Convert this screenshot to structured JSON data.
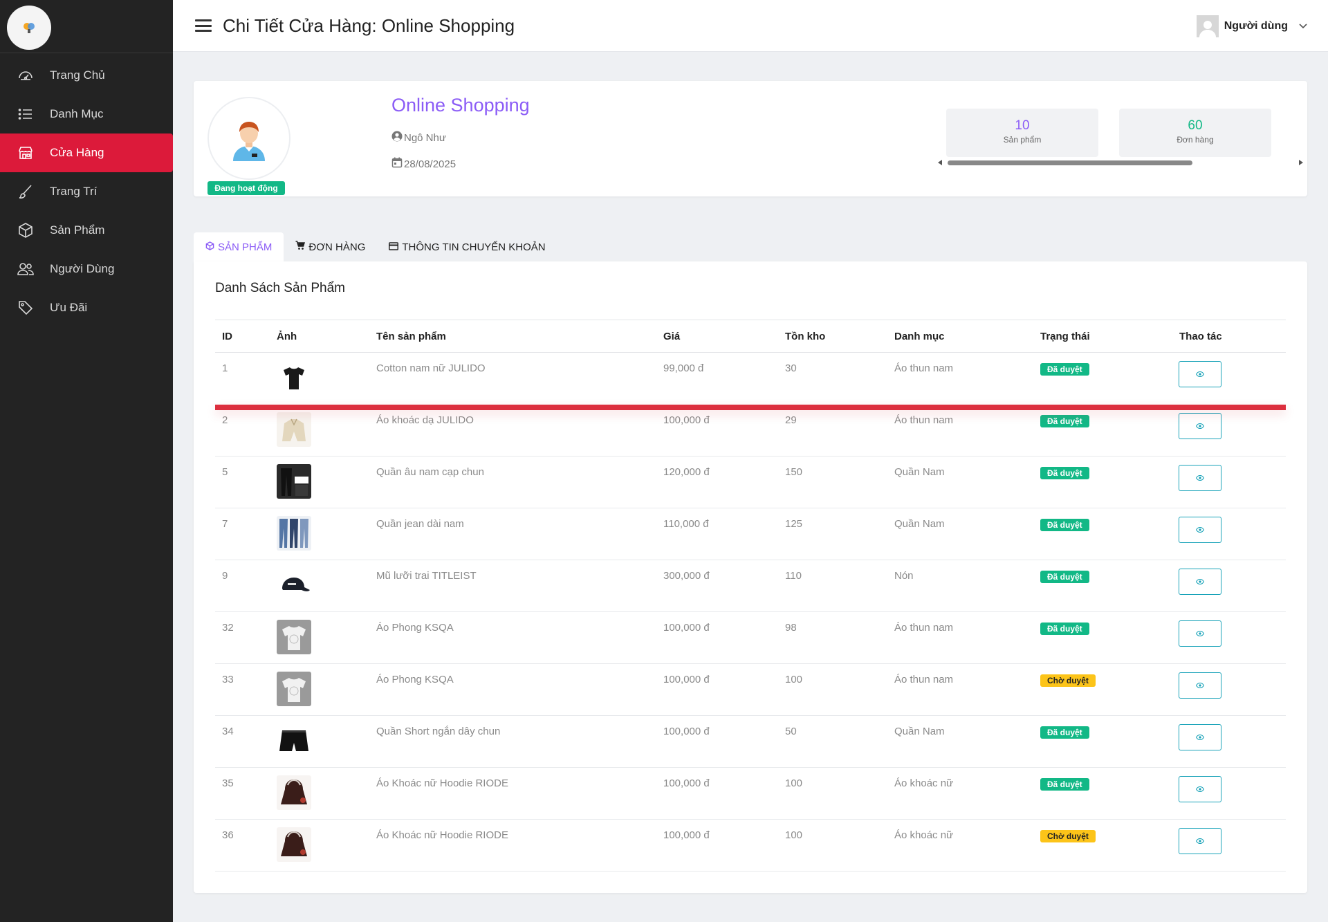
{
  "sidebar": {
    "items": [
      {
        "label": "Trang Chủ",
        "icon": "dashboard-icon"
      },
      {
        "label": "Danh Mục",
        "icon": "list-icon"
      },
      {
        "label": "Cửa Hàng",
        "icon": "store-icon",
        "active": true
      },
      {
        "label": "Trang Trí",
        "icon": "brush-icon"
      },
      {
        "label": "Sản Phẩm",
        "icon": "box-icon"
      },
      {
        "label": "Người Dùng",
        "icon": "users-icon"
      },
      {
        "label": "Ưu Đãi",
        "icon": "tag-icon"
      }
    ]
  },
  "header": {
    "title": "Chi Tiết Cửa Hàng: Online Shopping",
    "user_label": "Người dùng"
  },
  "shop": {
    "name": "Online Shopping",
    "owner": "Ngô Như",
    "date": "28/08/2025",
    "status": "Đang hoạt động",
    "stats": [
      {
        "value": "10",
        "label": "Sản phẩm"
      },
      {
        "value": "60",
        "label": "Đơn hàng"
      }
    ]
  },
  "tabs": [
    {
      "label": "SẢN PHẨM",
      "icon": "cube-icon",
      "active": true
    },
    {
      "label": "ĐƠN HÀNG",
      "icon": "cart-icon"
    },
    {
      "label": "THÔNG TIN CHUYỂN KHOẢN",
      "icon": "card-icon"
    }
  ],
  "products": {
    "title": "Danh Sách Sản Phẩm",
    "columns": [
      "ID",
      "Ảnh",
      "Tên sản phẩm",
      "Giá",
      "Tồn kho",
      "Danh mục",
      "Trạng thái",
      "Thao tác"
    ],
    "rows": [
      {
        "id": "1",
        "name": "Cotton nam nữ JULIDO",
        "price": "99,000 đ",
        "stock": "30",
        "category": "Áo thun nam",
        "status": "Đã duyệt",
        "status_type": "ok",
        "thumb": "black-tshirt"
      },
      {
        "id": "2",
        "name": "Áo khoác dạ JULIDO",
        "price": "100,000 đ",
        "stock": "29",
        "category": "Áo thun nam",
        "status": "Đã duyệt",
        "status_type": "ok",
        "thumb": "beige-jacket"
      },
      {
        "id": "5",
        "name": "Quần âu nam cạp chun",
        "price": "120,000 đ",
        "stock": "150",
        "category": "Quần Nam",
        "status": "Đã duyệt",
        "status_type": "ok",
        "thumb": "black-trousers"
      },
      {
        "id": "7",
        "name": "Quần jean dài nam",
        "price": "110,000 đ",
        "stock": "125",
        "category": "Quần Nam",
        "status": "Đã duyệt",
        "status_type": "ok",
        "thumb": "jeans"
      },
      {
        "id": "9",
        "name": "Mũ lưỡi trai TITLEIST",
        "price": "300,000 đ",
        "stock": "110",
        "category": "Nón",
        "status": "Đã duyệt",
        "status_type": "ok",
        "thumb": "cap"
      },
      {
        "id": "32",
        "name": "Áo Phong KSQA",
        "price": "100,000 đ",
        "stock": "98",
        "category": "Áo thun nam",
        "status": "Đã duyệt",
        "status_type": "ok",
        "thumb": "white-shirt"
      },
      {
        "id": "33",
        "name": "Áo Phong KSQA",
        "price": "100,000 đ",
        "stock": "100",
        "category": "Áo thun nam",
        "status": "Chờ duyệt",
        "status_type": "wait",
        "thumb": "white-shirt"
      },
      {
        "id": "34",
        "name": "Quần Short ngắn dây chun",
        "price": "100,000 đ",
        "stock": "50",
        "category": "Quần Nam",
        "status": "Đã duyệt",
        "status_type": "ok",
        "thumb": "black-shorts"
      },
      {
        "id": "35",
        "name": "Áo Khoác nữ Hoodie RIODE",
        "price": "100,000 đ",
        "stock": "100",
        "category": "Áo khoác nữ",
        "status": "Đã duyệt",
        "status_type": "ok",
        "thumb": "hoodie"
      },
      {
        "id": "36",
        "name": "Áo Khoác nữ Hoodie RIODE",
        "price": "100,000 đ",
        "stock": "100",
        "category": "Áo khoác nữ",
        "status": "Chờ duyệt",
        "status_type": "wait",
        "thumb": "hoodie"
      }
    ]
  },
  "colors": {
    "sidebar_bg": "#232323",
    "active_nav": "#dc1a3a",
    "accent_purple": "#8b5cf6",
    "approved_green": "#12b886",
    "pending_yellow": "#fcc419",
    "view_button": "#17a2b8"
  }
}
